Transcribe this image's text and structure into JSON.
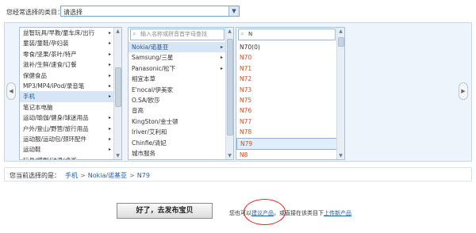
{
  "top": {
    "label": "您经常选择的类目：",
    "select_value": "请选择"
  },
  "col1": {
    "items": [
      {
        "label": "益智玩具/早教/童车床/出行",
        "arrow": true
      },
      {
        "label": "童装/童鞋/孕妇装",
        "arrow": true
      },
      {
        "label": "零食/坚果/茶叶/特产",
        "arrow": true
      },
      {
        "label": "滋补/生鲜/速食/订餐",
        "arrow": true
      },
      {
        "label": "保健食品",
        "arrow": true
      },
      {
        "label": "MP3/MP4/iPod/录音笔",
        "arrow": true
      },
      {
        "label": "手机",
        "arrow": true,
        "selected": true
      },
      {
        "label": "笔记本电脑",
        "arrow": false
      },
      {
        "label": "运动/瑜伽/健身/球迷用品",
        "arrow": true
      },
      {
        "label": "户外/登山/野营/旅行用品",
        "arrow": true
      },
      {
        "label": "运动服/运动包/颈环配件",
        "arrow": true
      },
      {
        "label": "运动鞋",
        "arrow": true
      },
      {
        "label": "玩具/模型/动漫/桌游",
        "arrow": true
      }
    ]
  },
  "col2": {
    "search_placeholder": "输入名称或拼音首字母查找",
    "items": [
      {
        "label": "Nokia/诺基亚",
        "arrow": true,
        "selected": true
      },
      {
        "label": "Samsung/三星",
        "arrow": true
      },
      {
        "label": "Panasonic/松下",
        "arrow": true
      },
      {
        "label": "相宜本草",
        "arrow": false
      },
      {
        "label": "E'nocal/伊美家",
        "arrow": false
      },
      {
        "label": "O.SA/欧莎",
        "arrow": false
      },
      {
        "label": "音高",
        "arrow": false
      },
      {
        "label": "KingSton/金士顿",
        "arrow": false
      },
      {
        "label": "Iriver/艾利和",
        "arrow": false
      },
      {
        "label": "Chinfie/清妃",
        "arrow": false
      },
      {
        "label": "城市服务",
        "arrow": false
      }
    ]
  },
  "col3": {
    "search_value": "N",
    "items": [
      {
        "label": "N70(0)",
        "red": false
      },
      {
        "label": "N70",
        "red": true
      },
      {
        "label": "N71",
        "red": true
      },
      {
        "label": "N72",
        "red": true
      },
      {
        "label": "N73",
        "red": true
      },
      {
        "label": "N75",
        "red": true
      },
      {
        "label": "N76",
        "red": true
      },
      {
        "label": "N77",
        "red": true
      },
      {
        "label": "N78",
        "red": true
      },
      {
        "label": "N79",
        "red": true,
        "selected": true
      },
      {
        "label": "N8",
        "red": true
      },
      {
        "label": "N80",
        "red": true
      }
    ]
  },
  "path": {
    "label": "您当前选择的是：",
    "crumbs": [
      "手机",
      "Nokia/诺基亚",
      "N79"
    ],
    "separator": ">"
  },
  "bottom": {
    "publish_label": "好了，去发布宝贝",
    "note_prefix": "您也可以",
    "suggest_link": "建议产品",
    "note_middle": "，或直接在该类目下",
    "upload_link": "上传新产品"
  },
  "icons": {
    "nav_left": "chevron-left-icon",
    "nav_right": "chevron-right-icon",
    "search": "magnifier-icon"
  },
  "colors": {
    "accent_red": "#d94a1a",
    "link": "#2460a7",
    "annotation_circle": "#e02020"
  }
}
